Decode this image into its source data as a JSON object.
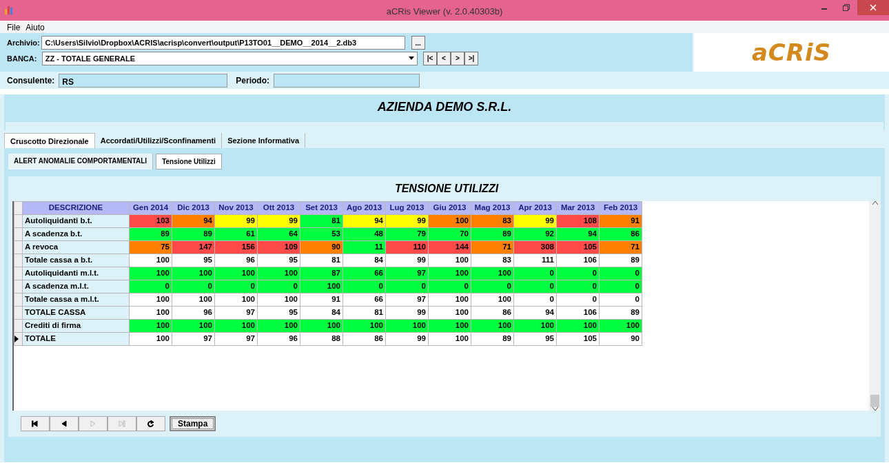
{
  "window": {
    "title": "aCRis Viewer (v. 2.0.40303b)"
  },
  "menu": [
    "File",
    "Aiuto"
  ],
  "header": {
    "archivio_label": "Archivio:",
    "archivio_value": "C:\\Users\\Silvio\\Dropbox\\ACRIS\\acrisp\\convert\\output\\P13TO01__DEMO__2014__2.db3",
    "browse": "...",
    "banca_label": "BANCA:",
    "banca_value": "ZZ - TOTALE GENERALE",
    "record_nav": [
      "|<",
      "<",
      ">",
      ">|"
    ],
    "logo": "aCRiS"
  },
  "consulente": {
    "label": "Consulente:",
    "value": "RS"
  },
  "periodo": {
    "label": "Periodo:"
  },
  "company": "AZIENDA DEMO S.R.L.",
  "tabs": [
    {
      "label": "Cruscotto Direzionale",
      "selected": true
    },
    {
      "label": "Accordati/Utilizzi/Sconfinamenti",
      "selected": false
    },
    {
      "label": "Sezione Informativa",
      "selected": false
    }
  ],
  "subtabs": [
    {
      "label": "ALERT ANOMALIE COMPORTAMENTALI",
      "selected": false
    },
    {
      "label": "Tensione Utilizzi",
      "selected": true
    }
  ],
  "grid_title": "TENSIONE UTILIZZI",
  "columns": [
    "DESCRIZIONE",
    "Gen 2014",
    "Dic 2013",
    "Nov 2013",
    "Ott 2013",
    "Set 2013",
    "Ago 2013",
    "Lug 2013",
    "Giu 2013",
    "Mag 2013",
    "Apr 2013",
    "Mar 2013",
    "Feb 2013"
  ],
  "rows": [
    {
      "label": "Autoliquidanti b.t.",
      "current": false,
      "cells": [
        {
          "v": "103",
          "color": "#ff4a4a"
        },
        {
          "v": "94",
          "color": "#ff8000"
        },
        {
          "v": "99",
          "color": "#ffff00"
        },
        {
          "v": "99",
          "color": "#ffff00"
        },
        {
          "v": "81",
          "color": "#00ff40"
        },
        {
          "v": "94",
          "color": "#ffff00"
        },
        {
          "v": "99",
          "color": "#ffff00"
        },
        {
          "v": "100",
          "color": "#ff8000"
        },
        {
          "v": "83",
          "color": "#ff8000"
        },
        {
          "v": "99",
          "color": "#ffff00"
        },
        {
          "v": "108",
          "color": "#ff4a4a"
        },
        {
          "v": "91",
          "color": "#ff8000"
        }
      ]
    },
    {
      "label": "A scadenza b.t.",
      "current": false,
      "cells": [
        {
          "v": "89",
          "color": "#00ff40"
        },
        {
          "v": "89",
          "color": "#00ff40"
        },
        {
          "v": "61",
          "color": "#00ff40"
        },
        {
          "v": "64",
          "color": "#00ff40"
        },
        {
          "v": "53",
          "color": "#00ff40"
        },
        {
          "v": "48",
          "color": "#00ff40"
        },
        {
          "v": "79",
          "color": "#00ff40"
        },
        {
          "v": "70",
          "color": "#00ff40"
        },
        {
          "v": "89",
          "color": "#00ff40"
        },
        {
          "v": "92",
          "color": "#00ff40"
        },
        {
          "v": "94",
          "color": "#00ff40"
        },
        {
          "v": "86",
          "color": "#00ff40"
        }
      ]
    },
    {
      "label": "A revoca",
      "current": false,
      "cells": [
        {
          "v": "75",
          "color": "#ff8000"
        },
        {
          "v": "147",
          "color": "#ff4a4a"
        },
        {
          "v": "156",
          "color": "#ff4a4a"
        },
        {
          "v": "109",
          "color": "#ff4a4a"
        },
        {
          "v": "90",
          "color": "#ff8000"
        },
        {
          "v": "11",
          "color": "#00ff40"
        },
        {
          "v": "110",
          "color": "#ff4a4a"
        },
        {
          "v": "144",
          "color": "#ff4a4a"
        },
        {
          "v": "71",
          "color": "#ff8000"
        },
        {
          "v": "308",
          "color": "#ff4a4a"
        },
        {
          "v": "105",
          "color": "#ff4a4a"
        },
        {
          "v": "71",
          "color": "#ff8000"
        }
      ]
    },
    {
      "label": "Totale cassa a b.t.",
      "current": false,
      "cells": [
        {
          "v": "100",
          "color": "#ffffff"
        },
        {
          "v": "95",
          "color": "#ffffff"
        },
        {
          "v": "96",
          "color": "#ffffff"
        },
        {
          "v": "95",
          "color": "#ffffff"
        },
        {
          "v": "81",
          "color": "#ffffff"
        },
        {
          "v": "84",
          "color": "#ffffff"
        },
        {
          "v": "99",
          "color": "#ffffff"
        },
        {
          "v": "100",
          "color": "#ffffff"
        },
        {
          "v": "83",
          "color": "#ffffff"
        },
        {
          "v": "111",
          "color": "#ffffff"
        },
        {
          "v": "106",
          "color": "#ffffff"
        },
        {
          "v": "89",
          "color": "#ffffff"
        }
      ]
    },
    {
      "label": "Autoliquidanti m.l.t.",
      "current": false,
      "cells": [
        {
          "v": "100",
          "color": "#00ff40"
        },
        {
          "v": "100",
          "color": "#00ff40"
        },
        {
          "v": "100",
          "color": "#00ff40"
        },
        {
          "v": "100",
          "color": "#00ff40"
        },
        {
          "v": "87",
          "color": "#00ff40"
        },
        {
          "v": "66",
          "color": "#00ff40"
        },
        {
          "v": "97",
          "color": "#00ff40"
        },
        {
          "v": "100",
          "color": "#00ff40"
        },
        {
          "v": "100",
          "color": "#00ff40"
        },
        {
          "v": "0",
          "color": "#00ff40"
        },
        {
          "v": "0",
          "color": "#00ff40"
        },
        {
          "v": "0",
          "color": "#00ff40"
        }
      ]
    },
    {
      "label": "A scadenza m.l.t.",
      "current": false,
      "cells": [
        {
          "v": "0",
          "color": "#00ff40"
        },
        {
          "v": "0",
          "color": "#00ff40"
        },
        {
          "v": "0",
          "color": "#00ff40"
        },
        {
          "v": "0",
          "color": "#00ff40"
        },
        {
          "v": "100",
          "color": "#00ff40"
        },
        {
          "v": "0",
          "color": "#00ff40"
        },
        {
          "v": "0",
          "color": "#00ff40"
        },
        {
          "v": "0",
          "color": "#00ff40"
        },
        {
          "v": "0",
          "color": "#00ff40"
        },
        {
          "v": "0",
          "color": "#00ff40"
        },
        {
          "v": "0",
          "color": "#00ff40"
        },
        {
          "v": "0",
          "color": "#00ff40"
        }
      ]
    },
    {
      "label": "Totale cassa a m.l.t.",
      "current": false,
      "cells": [
        {
          "v": "100",
          "color": "#ffffff"
        },
        {
          "v": "100",
          "color": "#ffffff"
        },
        {
          "v": "100",
          "color": "#ffffff"
        },
        {
          "v": "100",
          "color": "#ffffff"
        },
        {
          "v": "91",
          "color": "#ffffff"
        },
        {
          "v": "66",
          "color": "#ffffff"
        },
        {
          "v": "97",
          "color": "#ffffff"
        },
        {
          "v": "100",
          "color": "#ffffff"
        },
        {
          "v": "100",
          "color": "#ffffff"
        },
        {
          "v": "0",
          "color": "#ffffff"
        },
        {
          "v": "0",
          "color": "#ffffff"
        },
        {
          "v": "0",
          "color": "#ffffff"
        }
      ]
    },
    {
      "label": "TOTALE CASSA",
      "current": false,
      "cells": [
        {
          "v": "100",
          "color": "#ffffff"
        },
        {
          "v": "96",
          "color": "#ffffff"
        },
        {
          "v": "97",
          "color": "#ffffff"
        },
        {
          "v": "95",
          "color": "#ffffff"
        },
        {
          "v": "84",
          "color": "#ffffff"
        },
        {
          "v": "81",
          "color": "#ffffff"
        },
        {
          "v": "99",
          "color": "#ffffff"
        },
        {
          "v": "100",
          "color": "#ffffff"
        },
        {
          "v": "86",
          "color": "#ffffff"
        },
        {
          "v": "94",
          "color": "#ffffff"
        },
        {
          "v": "106",
          "color": "#ffffff"
        },
        {
          "v": "89",
          "color": "#ffffff"
        }
      ]
    },
    {
      "label": "Crediti di firma",
      "current": false,
      "cells": [
        {
          "v": "100",
          "color": "#00ff40"
        },
        {
          "v": "100",
          "color": "#00ff40"
        },
        {
          "v": "100",
          "color": "#00ff40"
        },
        {
          "v": "100",
          "color": "#00ff40"
        },
        {
          "v": "100",
          "color": "#00ff40"
        },
        {
          "v": "100",
          "color": "#00ff40"
        },
        {
          "v": "100",
          "color": "#00ff40"
        },
        {
          "v": "100",
          "color": "#00ff40"
        },
        {
          "v": "100",
          "color": "#00ff40"
        },
        {
          "v": "100",
          "color": "#00ff40"
        },
        {
          "v": "100",
          "color": "#00ff40"
        },
        {
          "v": "100",
          "color": "#00ff40"
        }
      ]
    },
    {
      "label": "TOTALE",
      "current": true,
      "cells": [
        {
          "v": "100",
          "color": "#ffffff"
        },
        {
          "v": "97",
          "color": "#ffffff"
        },
        {
          "v": "97",
          "color": "#ffffff"
        },
        {
          "v": "96",
          "color": "#ffffff"
        },
        {
          "v": "88",
          "color": "#ffffff"
        },
        {
          "v": "86",
          "color": "#ffffff"
        },
        {
          "v": "99",
          "color": "#ffffff"
        },
        {
          "v": "100",
          "color": "#ffffff"
        },
        {
          "v": "89",
          "color": "#ffffff"
        },
        {
          "v": "95",
          "color": "#ffffff"
        },
        {
          "v": "105",
          "color": "#ffffff"
        },
        {
          "v": "90",
          "color": "#ffffff"
        }
      ]
    }
  ],
  "navigator": [
    {
      "kind": "first",
      "disabled": false
    },
    {
      "kind": "prior",
      "disabled": false
    },
    {
      "kind": "next",
      "disabled": true
    },
    {
      "kind": "last",
      "disabled": true
    },
    {
      "kind": "refresh",
      "disabled": false
    }
  ],
  "print_button": "Stampa"
}
